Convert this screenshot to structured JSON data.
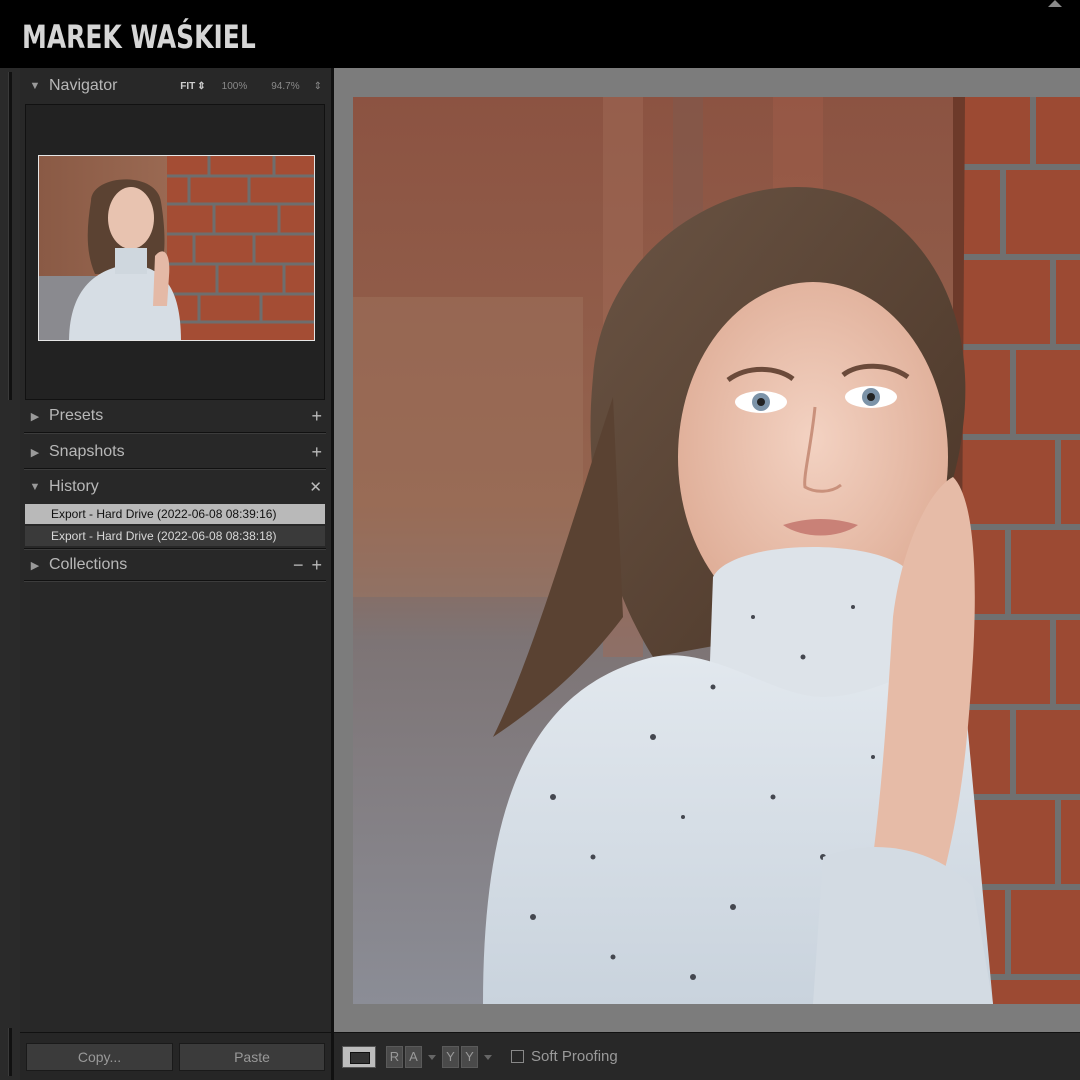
{
  "identity_plate": "MAREK WAŚKIEL",
  "navigator": {
    "title": "Navigator",
    "zoom_fit": "FIT",
    "zoom_100": "100%",
    "zoom_custom": "94.7%"
  },
  "panels": {
    "presets": "Presets",
    "snapshots": "Snapshots",
    "history": "History",
    "collections": "Collections"
  },
  "history_items": [
    "Export - Hard Drive (2022-06-08 08:39:16)",
    "Export - Hard Drive (2022-06-08 08:38:18)"
  ],
  "buttons": {
    "copy": "Copy...",
    "paste": "Paste"
  },
  "toolbar": {
    "compare_ra": "RA",
    "compare_yy": "YY",
    "soft_proofing": "Soft Proofing"
  },
  "icons": {
    "expand": "triangle-right-icon",
    "collapse": "triangle-down-icon",
    "add": "plus-icon",
    "remove": "minus-icon",
    "clear": "close-icon",
    "loupe_view": "loupe-view-icon"
  }
}
